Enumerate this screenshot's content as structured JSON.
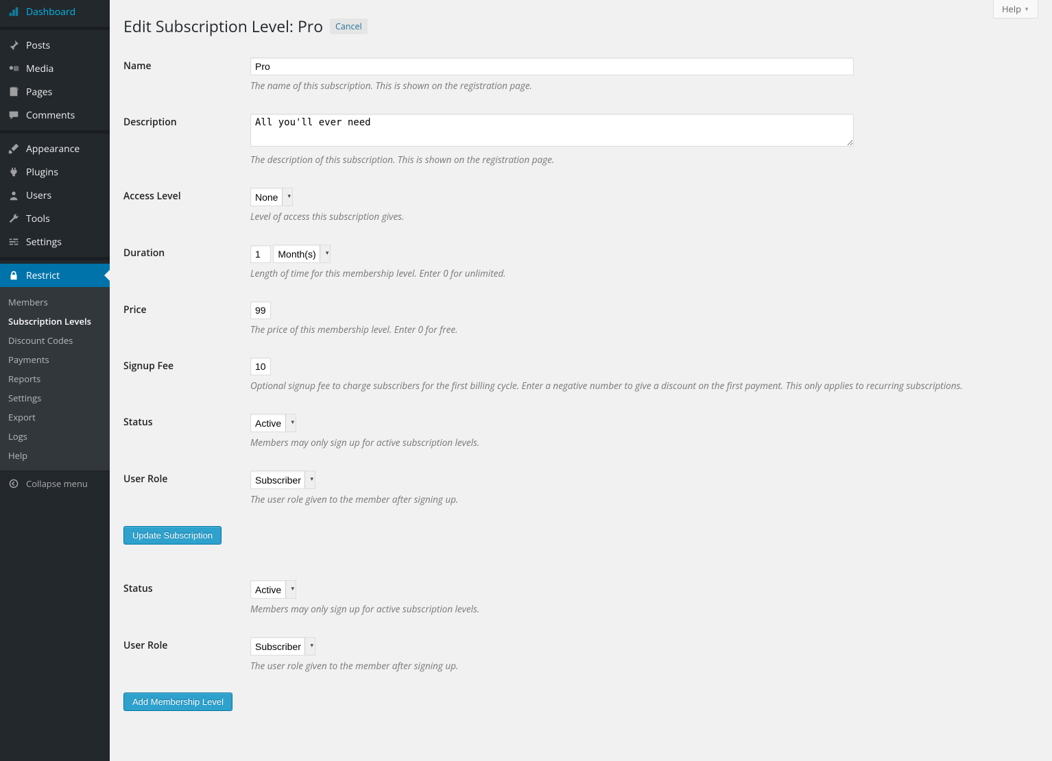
{
  "sidebar": {
    "items": [
      {
        "label": "Dashboard",
        "icon": "dashboard"
      },
      {
        "label": "Posts",
        "icon": "pin"
      },
      {
        "label": "Media",
        "icon": "media"
      },
      {
        "label": "Pages",
        "icon": "pages"
      },
      {
        "label": "Comments",
        "icon": "comments"
      },
      {
        "label": "Appearance",
        "icon": "brush"
      },
      {
        "label": "Plugins",
        "icon": "plug"
      },
      {
        "label": "Users",
        "icon": "user"
      },
      {
        "label": "Tools",
        "icon": "wrench"
      },
      {
        "label": "Settings",
        "icon": "sliders"
      },
      {
        "label": "Restrict",
        "icon": "lock"
      }
    ],
    "submenu": [
      "Members",
      "Subscription Levels",
      "Discount Codes",
      "Payments",
      "Reports",
      "Settings",
      "Export",
      "Logs",
      "Help"
    ],
    "collapse": "Collapse menu"
  },
  "header": {
    "help": "Help",
    "title_prefix": "Edit Subscription Level: ",
    "title_name": "Pro",
    "cancel": "Cancel"
  },
  "form": {
    "name": {
      "label": "Name",
      "value": "Pro",
      "desc": "The name of this subscription. This is shown on the registration page."
    },
    "description": {
      "label": "Description",
      "value": "All you'll ever need",
      "desc": "The description of this subscription. This is shown on the registration page."
    },
    "access": {
      "label": "Access Level",
      "value": "None",
      "desc": "Level of access this subscription gives."
    },
    "duration": {
      "label": "Duration",
      "value": "1",
      "unit": "Month(s)",
      "desc": "Length of time for this membership level. Enter 0 for unlimited."
    },
    "price": {
      "label": "Price",
      "value": "99",
      "desc": "The price of this membership level. Enter 0 for free."
    },
    "signup": {
      "label": "Signup Fee",
      "value": "10",
      "desc": "Optional signup fee to charge subscribers for the first billing cycle. Enter a negative number to give a discount on the first payment. This only applies to recurring subscriptions."
    },
    "status": {
      "label": "Status",
      "value": "Active",
      "desc": "Members may only sign up for active subscription levels."
    },
    "role": {
      "label": "User Role",
      "value": "Subscriber",
      "desc": "The user role given to the member after signing up."
    },
    "update_btn": "Update Subscription",
    "status2": {
      "label": "Status",
      "value": "Active",
      "desc": "Members may only sign up for active subscription levels."
    },
    "role2": {
      "label": "User Role",
      "value": "Subscriber",
      "desc": "The user role given to the member after signing up."
    },
    "add_btn": "Add Membership Level"
  }
}
